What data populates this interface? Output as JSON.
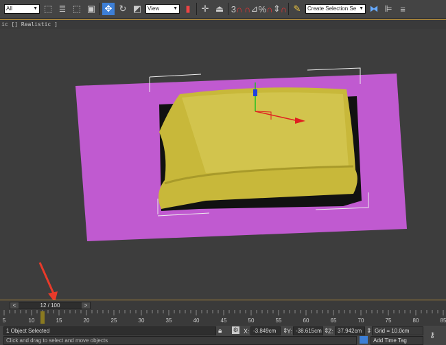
{
  "toolbar": {
    "selection_filter": "All",
    "reference_coord": "View",
    "named_selection": "Create Selection Se",
    "snap_label": "3",
    "percent_label": "%"
  },
  "viewport": {
    "label": "ic [] Realistic ]",
    "colors": {
      "plane": "#c05ad0",
      "object": "#c8b83a",
      "background": "#3d3d3d",
      "annotation_arrow": "#e83a2a"
    }
  },
  "timeline": {
    "current": "12 / 100",
    "current_frame": 12,
    "total_frames": 100,
    "prev": "<",
    "next": ">",
    "ticks": [
      "5",
      "10",
      "15",
      "20",
      "25",
      "30",
      "35",
      "40",
      "45",
      "50",
      "55",
      "60",
      "65",
      "70",
      "75",
      "80",
      "85"
    ]
  },
  "status": {
    "selected": "1 Object Selected",
    "prompt": "Click and drag to select and move objects",
    "x_label": "X:",
    "x": "-3.849cm",
    "y_label": "Y:",
    "y": "-38.615cm",
    "z_label": "Z:",
    "z": "37.942cm",
    "grid": "Grid = 10.0cm",
    "add_time_tag": "Add Time Tag"
  }
}
